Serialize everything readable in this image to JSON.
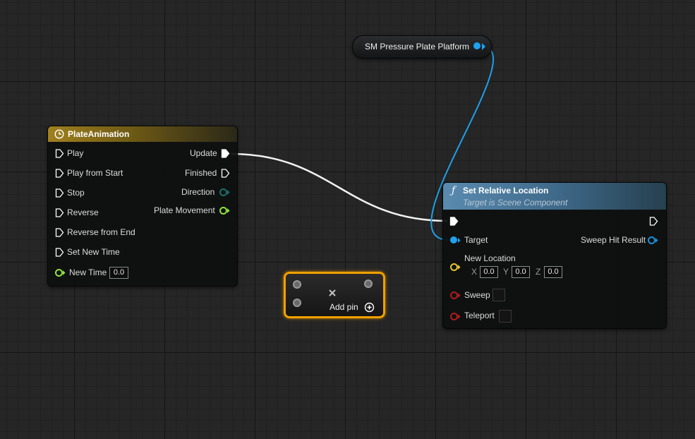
{
  "colors": {
    "exec": "#ffffff",
    "float": "#8fe33c",
    "vector": "#e6c42a",
    "object": "#1ea3f0",
    "bool": "#b01c1c",
    "timeline_header": "#9a7a1c",
    "function_header": "#4f7fa4",
    "reroute_border": "#f0a000"
  },
  "get_node": {
    "label": "SM Pressure Plate Platform",
    "pin_type": "object"
  },
  "timeline": {
    "icon": "clock-icon",
    "title": "PlateAnimation",
    "inputs": [
      {
        "label": "Play",
        "pin": "exec"
      },
      {
        "label": "Play from Start",
        "pin": "exec"
      },
      {
        "label": "Stop",
        "pin": "exec"
      },
      {
        "label": "Reverse",
        "pin": "exec"
      },
      {
        "label": "Reverse from End",
        "pin": "exec"
      },
      {
        "label": "Set New Time",
        "pin": "exec"
      },
      {
        "label": "New Time",
        "pin": "float",
        "value": "0.0"
      }
    ],
    "outputs": [
      {
        "label": "Update",
        "pin": "exec"
      },
      {
        "label": "Finished",
        "pin": "exec"
      },
      {
        "label": "Direction",
        "pin": "enum"
      },
      {
        "label": "Plate Movement",
        "pin": "float"
      }
    ]
  },
  "set_location": {
    "icon": "function-icon",
    "title": "Set Relative Location",
    "subtitle": "Target is Scene Component",
    "target_label": "Target",
    "sweep_hit_label": "Sweep Hit Result",
    "new_location_label": "New Location",
    "x_label": "X",
    "x_value": "0.0",
    "y_label": "Y",
    "y_value": "0.0",
    "z_label": "Z",
    "z_value": "0.0",
    "sweep_label": "Sweep",
    "teleport_label": "Teleport"
  },
  "reroute_node": {
    "add_pin_label": "Add pin",
    "close_icon": "close-icon",
    "add_icon": "plus-circle-icon"
  }
}
